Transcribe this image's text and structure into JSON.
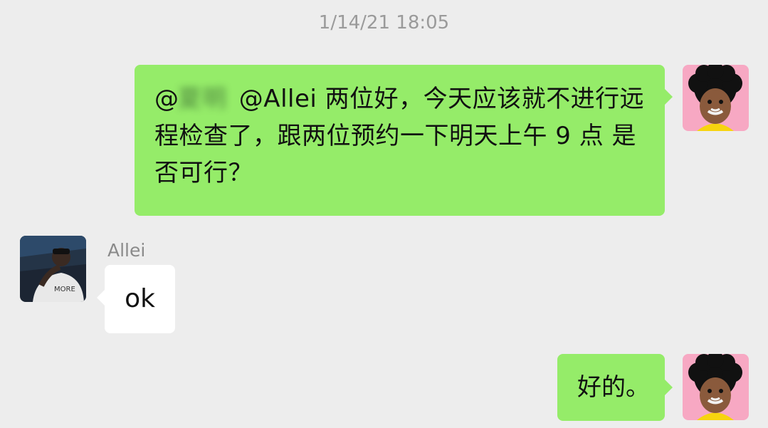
{
  "timestamp": "1/14/21 18:05",
  "messages": [
    {
      "side": "right",
      "mention_prefix": "@",
      "blurred_name": "夏明",
      "text": " @Allei 两位好，今天应该就不进行远程检查了，跟两位预约一下明天上午 9 点 是否可行？"
    },
    {
      "side": "left",
      "sender": "Allei",
      "text": "ok"
    },
    {
      "side": "right",
      "text": "好的。"
    }
  ],
  "colors": {
    "background": "#ededed",
    "outgoing_bubble": "#95ec69",
    "incoming_bubble": "#ffffff",
    "timestamp_text": "#9a9a9a"
  },
  "icons": {
    "self_avatar": "cartoon-afro-avatar-icon",
    "other_avatar": "photo-avatar-icon"
  }
}
